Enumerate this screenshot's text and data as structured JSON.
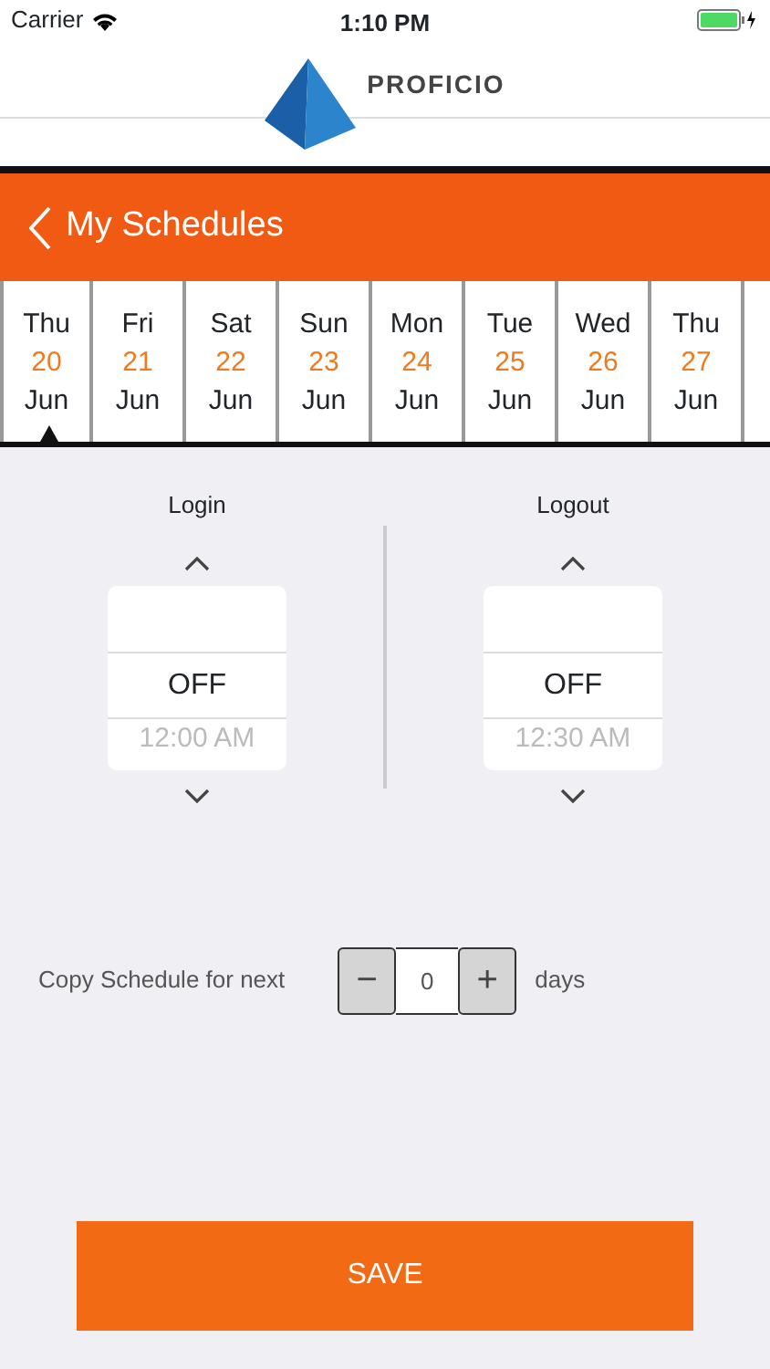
{
  "status_bar": {
    "carrier": "Carrier",
    "time": "1:10 PM"
  },
  "logo": {
    "text": "PROFICIO"
  },
  "header": {
    "title": "My Schedules"
  },
  "days": [
    {
      "weekday": "Thu",
      "date": "20",
      "month": "Jun",
      "selected": true
    },
    {
      "weekday": "Fri",
      "date": "21",
      "month": "Jun",
      "selected": false
    },
    {
      "weekday": "Sat",
      "date": "22",
      "month": "Jun",
      "selected": false
    },
    {
      "weekday": "Sun",
      "date": "23",
      "month": "Jun",
      "selected": false
    },
    {
      "weekday": "Mon",
      "date": "24",
      "month": "Jun",
      "selected": false
    },
    {
      "weekday": "Tue",
      "date": "25",
      "month": "Jun",
      "selected": false
    },
    {
      "weekday": "Wed",
      "date": "26",
      "month": "Jun",
      "selected": false
    },
    {
      "weekday": "Thu",
      "date": "27",
      "month": "Jun",
      "selected": false
    }
  ],
  "pickers": [
    {
      "label": "Login",
      "value": "OFF",
      "next_value": "12:00 AM"
    },
    {
      "label": "Logout",
      "value": "OFF",
      "next_value": "12:30 AM"
    }
  ],
  "copy": {
    "label": "Copy Schedule for next",
    "minus": "−",
    "value": "0",
    "plus": "+",
    "unit": "days"
  },
  "save_button": "SAVE"
}
